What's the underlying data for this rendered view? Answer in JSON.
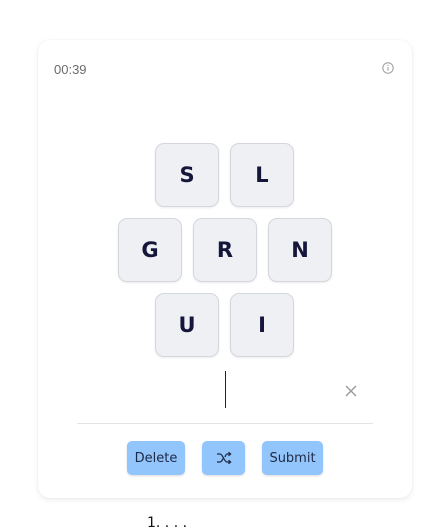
{
  "timer": "00:39",
  "tiles": {
    "top": [
      "S",
      "L"
    ],
    "middle": [
      "G",
      "R",
      "N"
    ],
    "bottom": [
      "U",
      "I"
    ]
  },
  "buttons": {
    "delete": "Delete",
    "submit": "Submit"
  },
  "footer": "1. . . .",
  "icons": {
    "info": "info-icon",
    "clear": "close-icon",
    "shuffle": "shuffle-icon"
  },
  "colors": {
    "tile_bg": "#eef0f4",
    "button_bg": "#93c5fd",
    "letter": "#16163a"
  }
}
